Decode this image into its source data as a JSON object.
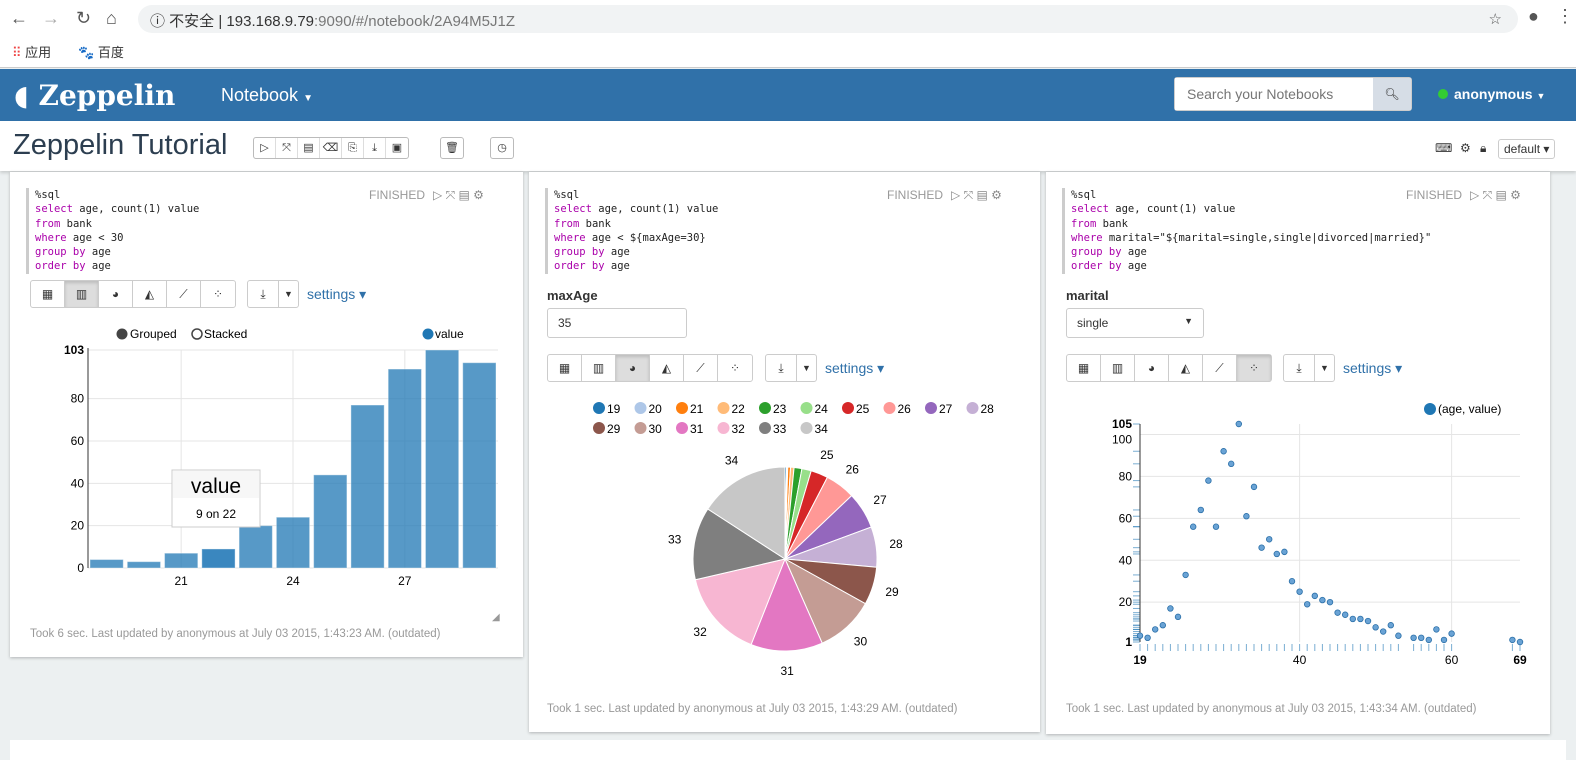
{
  "browser": {
    "security": "不安全",
    "url_host": "193.168.9.79",
    "url_rest": ":9090/#/notebook/2A94M5J1Z",
    "bookmarks": [
      "应用",
      "百度"
    ]
  },
  "navbar": {
    "brand": "Zeppelin",
    "notebook_menu": "Notebook",
    "search_placeholder": "Search your Notebooks",
    "user": "anonymous",
    "bg": "#3071a9"
  },
  "notebook": {
    "title": "Zeppelin Tutorial",
    "interpreter": "default"
  },
  "paragraphs": [
    {
      "code": [
        "%sql",
        "select age, count(1) value",
        "from bank",
        "where age < 30",
        "group by age",
        "order by age"
      ],
      "status": "FINISHED",
      "settings": "settings",
      "footer": "Took 6 sec. Last updated by anonymous at July 03 2015, 1:43:23 AM. (outdated)",
      "active_view": "bar"
    },
    {
      "code": [
        "%sql",
        "select age, count(1) value",
        "from bank",
        "where age < ${maxAge=30}",
        "group by age",
        "order by age"
      ],
      "status": "FINISHED",
      "settings": "settings",
      "form_label": "maxAge",
      "form_value": "35",
      "footer": "Took 1 sec. Last updated by anonymous at July 03 2015, 1:43:29 AM. (outdated)",
      "active_view": "pie"
    },
    {
      "code": [
        "%sql",
        "select age, count(1) value",
        "from bank",
        "where marital=\"${marital=single,single|divorced|married}\"",
        "group by age",
        "order by age"
      ],
      "status": "FINISHED",
      "settings": "settings",
      "form_label": "marital",
      "form_value": "single",
      "footer": "Took 1 sec. Last updated by anonymous at July 03 2015, 1:43:34 AM. (outdated)",
      "active_view": "scatter"
    }
  ],
  "chart_data": [
    {
      "type": "bar",
      "categories": [
        19,
        20,
        21,
        22,
        23,
        24,
        25,
        26,
        27,
        28,
        29
      ],
      "series": [
        {
          "name": "value",
          "values": [
            4,
            3,
            7,
            9,
            20,
            24,
            44,
            77,
            94,
            103,
            97
          ]
        }
      ],
      "ylim": [
        0,
        103
      ],
      "yticks": [
        0,
        20,
        40,
        60,
        80,
        103
      ],
      "xticks": [
        21,
        24,
        27
      ],
      "legend": [
        "Grouped",
        "Stacked"
      ],
      "tooltip": {
        "title": "value",
        "text": "9 on 22"
      },
      "color": "#1f77b4"
    },
    {
      "type": "pie",
      "categories": [
        "19",
        "20",
        "21",
        "22",
        "23",
        "24",
        "25",
        "26",
        "27",
        "28",
        "29",
        "30",
        "31",
        "32",
        "33",
        "34"
      ],
      "values": [
        4,
        3,
        7,
        9,
        20,
        24,
        44,
        77,
        94,
        103,
        97,
        150,
        184,
        224,
        186,
        231
      ],
      "colors": [
        "#1f77b4",
        "#aec7e8",
        "#ff7f0e",
        "#ffbb78",
        "#2ca02c",
        "#98df8a",
        "#d62728",
        "#ff9896",
        "#9467bd",
        "#c5b0d5",
        "#8c564b",
        "#c49c94",
        "#e377c2",
        "#f7b6d2",
        "#7f7f7f",
        "#c7c7c7"
      ]
    },
    {
      "type": "scatter",
      "series": [
        {
          "name": "(age, value)",
          "x": [
            19,
            20,
            21,
            22,
            23,
            24,
            25,
            26,
            27,
            28,
            29,
            30,
            31,
            32,
            33,
            34,
            35,
            36,
            37,
            38,
            39,
            40,
            41,
            42,
            43,
            44,
            45,
            46,
            47,
            48,
            49,
            50,
            51,
            52,
            53,
            55,
            56,
            57,
            58,
            59,
            60,
            68,
            69
          ],
          "y": [
            4,
            3,
            7,
            9,
            17,
            13,
            33,
            56,
            64,
            78,
            56,
            92,
            86,
            105,
            61,
            75,
            46,
            50,
            43,
            44,
            30,
            25,
            19,
            23,
            21,
            20,
            15,
            14,
            12,
            12,
            11,
            8,
            6,
            9,
            4,
            3,
            3,
            2,
            7,
            2,
            5,
            2,
            1
          ]
        }
      ],
      "xlim": [
        19,
        69
      ],
      "ylim": [
        1,
        105
      ],
      "xticks": [
        19,
        40,
        60,
        69
      ],
      "yticks": [
        1,
        20,
        40,
        60,
        80,
        100,
        105
      ],
      "color": "#1f77b4"
    }
  ]
}
